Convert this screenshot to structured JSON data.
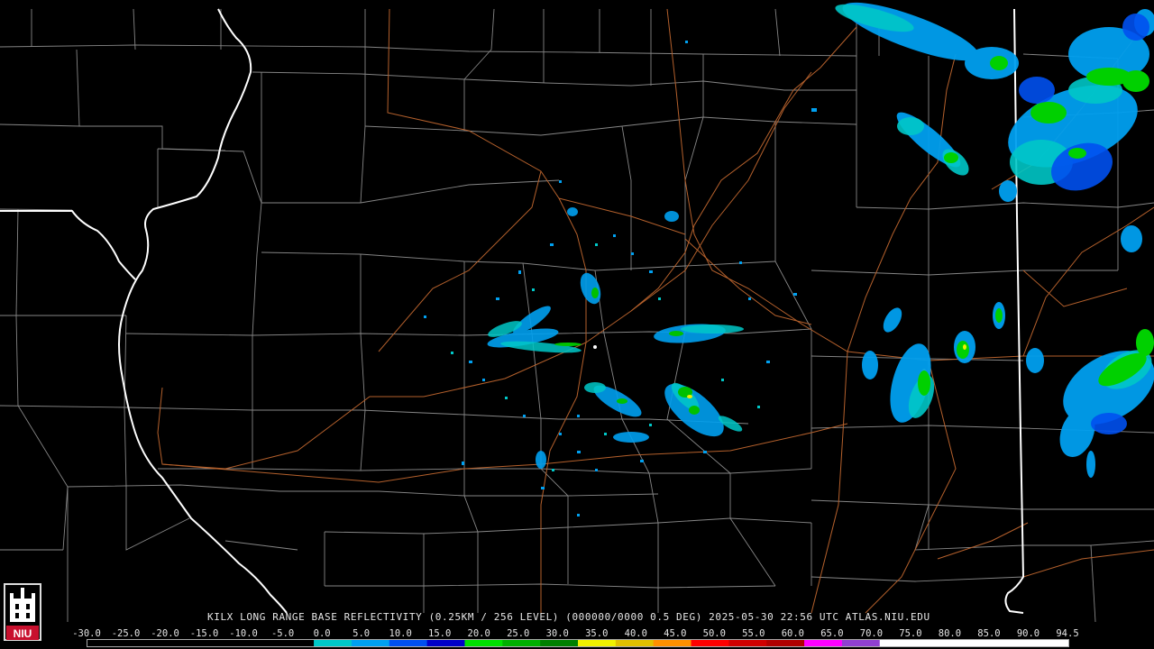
{
  "product": {
    "caption": "KILX LONG RANGE BASE REFLECTIVITY (0.25KM / 256 LEVEL) (000000/0000 0.5 DEG) 2025-05-30 22:56 UTC  ATLAS.NIU.EDU"
  },
  "logo": {
    "label": "NIU",
    "brand_color": "#c8102e"
  },
  "scale": {
    "labels": [
      "-30.0",
      "-25.0",
      "-20.0",
      "-15.0",
      "-10.0",
      "-5.0",
      "0.0",
      "5.0",
      "10.0",
      "15.0",
      "20.0",
      "25.0",
      "30.0",
      "35.0",
      "40.0",
      "45.0",
      "50.0",
      "55.0",
      "60.0",
      "65.0",
      "70.0",
      "75.0",
      "80.0",
      "85.0",
      "90.0",
      "94.5"
    ],
    "colors": [
      "#000000",
      "#000000",
      "#000000",
      "#000000",
      "#000000",
      "#000000",
      "#00c8c8",
      "#00a0f0",
      "#0050f0",
      "#0000c8",
      "#00e000",
      "#00b000",
      "#008000",
      "#f0f000",
      "#e0c000",
      "#ff9000",
      "#ff0000",
      "#d00000",
      "#b00000",
      "#ff00ff",
      "#9040d0",
      "#ffffff",
      "#ffffff",
      "#ffffff",
      "#ffffff",
      "#ffffff"
    ]
  },
  "map_colors": {
    "state_border": "#ffffff",
    "county_border": "#a8a8a8",
    "roads": "#b4602c",
    "background": "#000000"
  }
}
